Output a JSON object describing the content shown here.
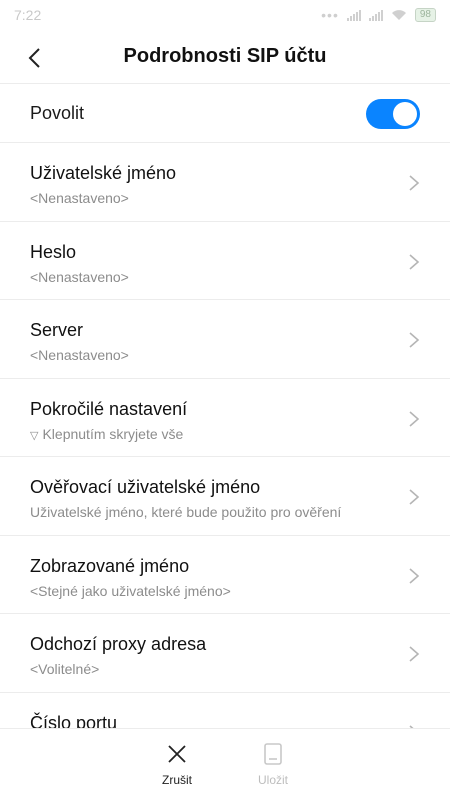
{
  "status_bar": {
    "time": "7:22",
    "battery": "98"
  },
  "header": {
    "title": "Podrobnosti SIP účtu"
  },
  "enable": {
    "label": "Povolit",
    "on": true
  },
  "rows": [
    {
      "label": "Uživatelské jméno",
      "sub": "<Nenastaveno>"
    },
    {
      "label": "Heslo",
      "sub": "<Nenastaveno>"
    },
    {
      "label": "Server",
      "sub": "<Nenastaveno>"
    },
    {
      "label": "Pokročilé nastavení",
      "sub": "Klepnutím skryjete vše",
      "prefix": "▽"
    },
    {
      "label": "Ověřovací uživatelské jméno",
      "sub": "Uživatelské jméno, které bude použito pro ověření"
    },
    {
      "label": "Zobrazované jméno",
      "sub": "<Stejné jako uživatelské jméno>"
    },
    {
      "label": "Odchozí proxy adresa",
      "sub": "<Volitelné>"
    },
    {
      "label": "Číslo portu",
      "sub": ""
    }
  ],
  "bottom": {
    "cancel": "Zrušit",
    "save": "Uložit"
  },
  "colors": {
    "accent": "#0a84ff",
    "divider": "#ececec",
    "secondary_text": "#8c8c8c"
  },
  "icons": {
    "back": "chevron-left-icon",
    "row": "chevron-right-icon",
    "cancel": "close-icon",
    "save": "save-icon"
  }
}
